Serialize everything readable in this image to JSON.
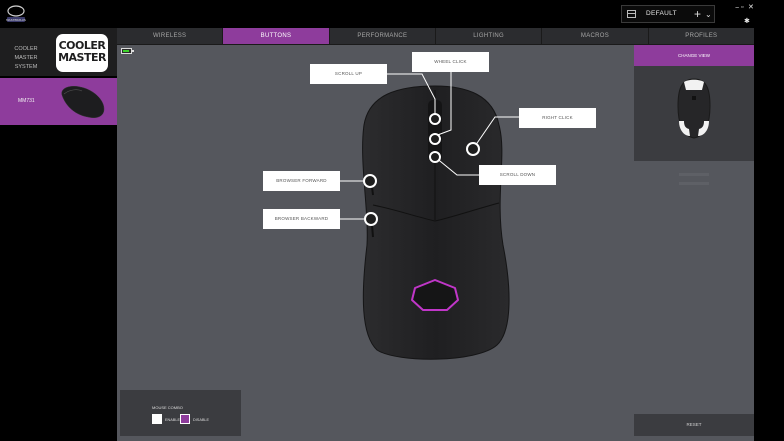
{
  "app": {
    "logo_icon": "masterplus-logo-icon"
  },
  "profile": {
    "name": "DEFAULT",
    "add_label": "+",
    "chevron": "⌄",
    "icon": "profile-folder-icon"
  },
  "window": {
    "minimize": "−",
    "maximize": "▫",
    "close": "✕",
    "tools": "✱"
  },
  "sidebar": {
    "system_label": "COOLER MASTER SYSTEM",
    "logo_text_1": "COOLER",
    "logo_text_2": "MASTER",
    "device_label": "MM731"
  },
  "tabs": [
    {
      "label": "WIRELESS",
      "active": false
    },
    {
      "label": "BUTTONS",
      "active": true
    },
    {
      "label": "PERFORMANCE",
      "active": false
    },
    {
      "label": "LIGHTING",
      "active": false
    },
    {
      "label": "MACROS",
      "active": false
    },
    {
      "label": "PROFILES",
      "active": false
    }
  ],
  "buttons": {
    "scroll_up": "SCROLL UP",
    "wheel_click": "WHEEL CLICK",
    "right_click": "RIGHT CLICK",
    "scroll_down": "SCROLL DOWN",
    "browser_forward": "BROWSER FORWARD",
    "browser_backward": "BROWSER BACKWARD"
  },
  "right_panel": {
    "change_view": "CHANGE VIEW",
    "reset": "RESET"
  },
  "mouse_combo": {
    "title": "MOUSE COMBO",
    "enable": "ENABLE",
    "disable": "DISABLE"
  },
  "colors": {
    "accent": "#8e3c9c",
    "battery": "#3cd32a",
    "logo_ring": "#c036c8"
  }
}
